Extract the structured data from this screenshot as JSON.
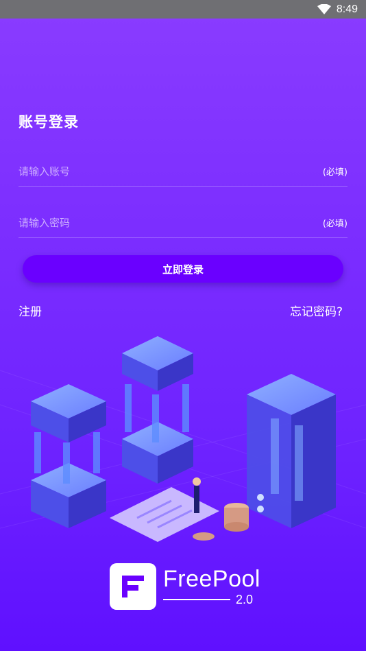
{
  "status_bar": {
    "time": "8:49",
    "wifi_icon": "wifi-icon"
  },
  "login": {
    "title": "账号登录",
    "account_placeholder": "请输入账号",
    "account_required": "(必填)",
    "password_placeholder": "请输入密码",
    "password_required": "(必填)",
    "submit_label": "立即登录",
    "register_label": "注册",
    "forgot_label": "忘记密码?"
  },
  "brand": {
    "name": "FreePool",
    "version": "2.0",
    "logo_icon": "freepool-logo-icon"
  },
  "colors": {
    "background": "#7426ff",
    "button": "#6a00ff",
    "status_bar": "#6f6f73"
  }
}
